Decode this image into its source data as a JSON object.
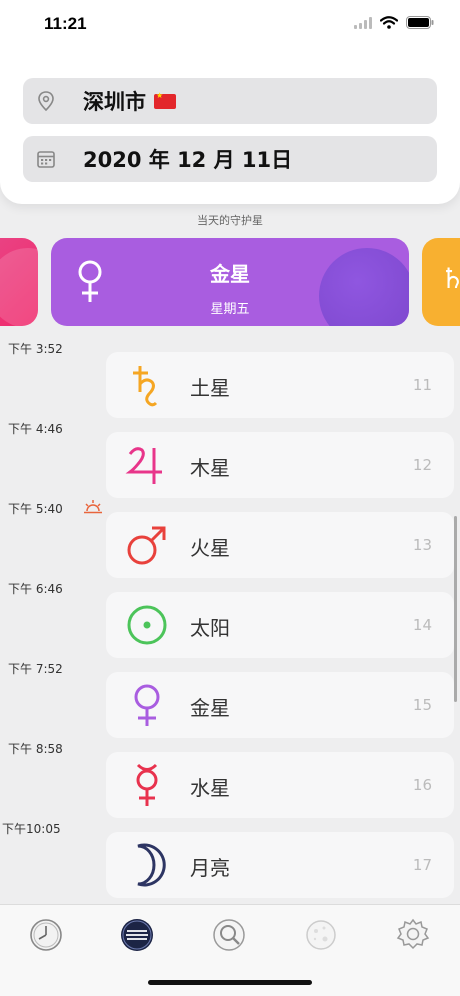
{
  "status": {
    "time": "11:21"
  },
  "location": {
    "city": "深圳市"
  },
  "date": {
    "value": "2020 年 12 月 11日"
  },
  "guardian": {
    "caption": "当天的守护星",
    "planet": "金星",
    "weekday": "星期五",
    "colors": {
      "prev": "#f0286b",
      "main": "#a95de0",
      "next": "#f8b030"
    }
  },
  "hours": [
    {
      "time": "下午 3:52",
      "planet": "土星",
      "number": "11",
      "symbol": "saturn-icon",
      "color": "#f5a623"
    },
    {
      "time": "下午 4:46",
      "planet": "木星",
      "number": "12",
      "symbol": "jupiter-icon",
      "color": "#e8358a"
    },
    {
      "time": "下午 5:40",
      "planet": "火星",
      "number": "13",
      "symbol": "mars-icon",
      "color": "#e8413c"
    },
    {
      "time": "下午 6:46",
      "planet": "太阳",
      "number": "14",
      "symbol": "sun-icon",
      "color": "#4cc45a"
    },
    {
      "time": "下午 7:52",
      "planet": "金星",
      "number": "15",
      "symbol": "venus-icon",
      "color": "#a95de0"
    },
    {
      "time": "下午 8:58",
      "planet": "水星",
      "number": "16",
      "symbol": "mercury-icon",
      "color": "#e8324e"
    },
    {
      "time": "下午10:05",
      "planet": "月亮",
      "number": "17",
      "symbol": "moon-icon",
      "color": "#2d3563"
    }
  ],
  "tabs": [
    "clock-icon",
    "planetary-hours-icon",
    "search-icon",
    "moon-phase-icon",
    "settings-icon"
  ]
}
